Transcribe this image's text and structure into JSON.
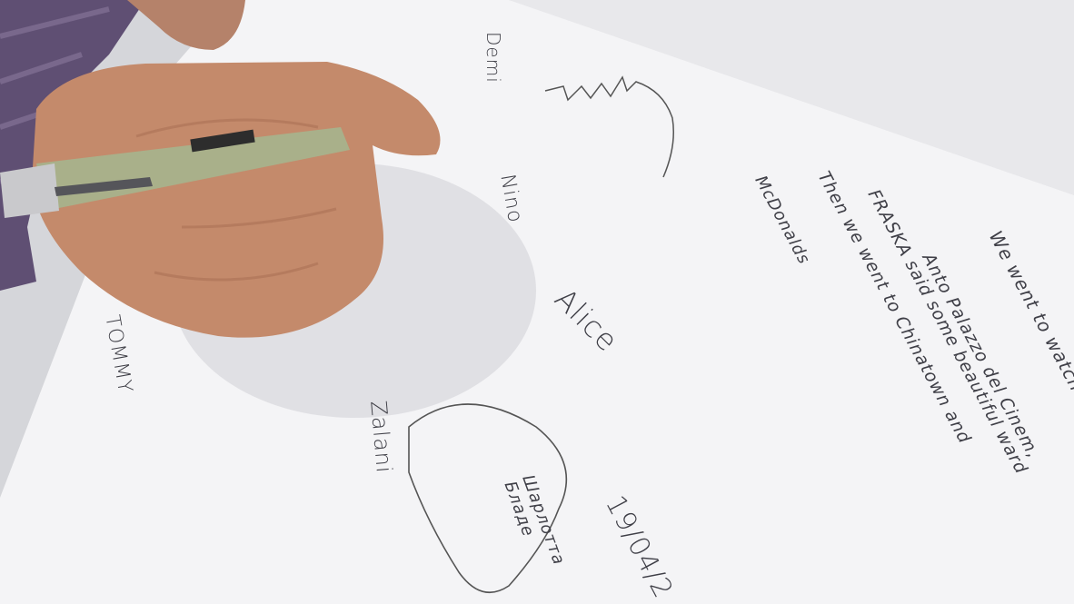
{
  "page": {
    "handwriting": {
      "story_lines": [
        "We went to watch Buena Vis",
        "Anto Palazzo del Cinem,",
        "FRASKA said some beautiful ward",
        "Then we went to Chinatown and",
        "McDonalds"
      ],
      "signatures": [
        "Demi",
        "Nino",
        "Alice",
        "TOMMY",
        "Zalani"
      ],
      "date": "19/04/2",
      "heart_text": "Шарлотта Бладе"
    },
    "colors": {
      "paper": "#f4f4f6",
      "ink": "#3f3f47",
      "table": "#d9dadd",
      "skin": "#c9906f",
      "pen_body": "#a9b08a"
    }
  }
}
